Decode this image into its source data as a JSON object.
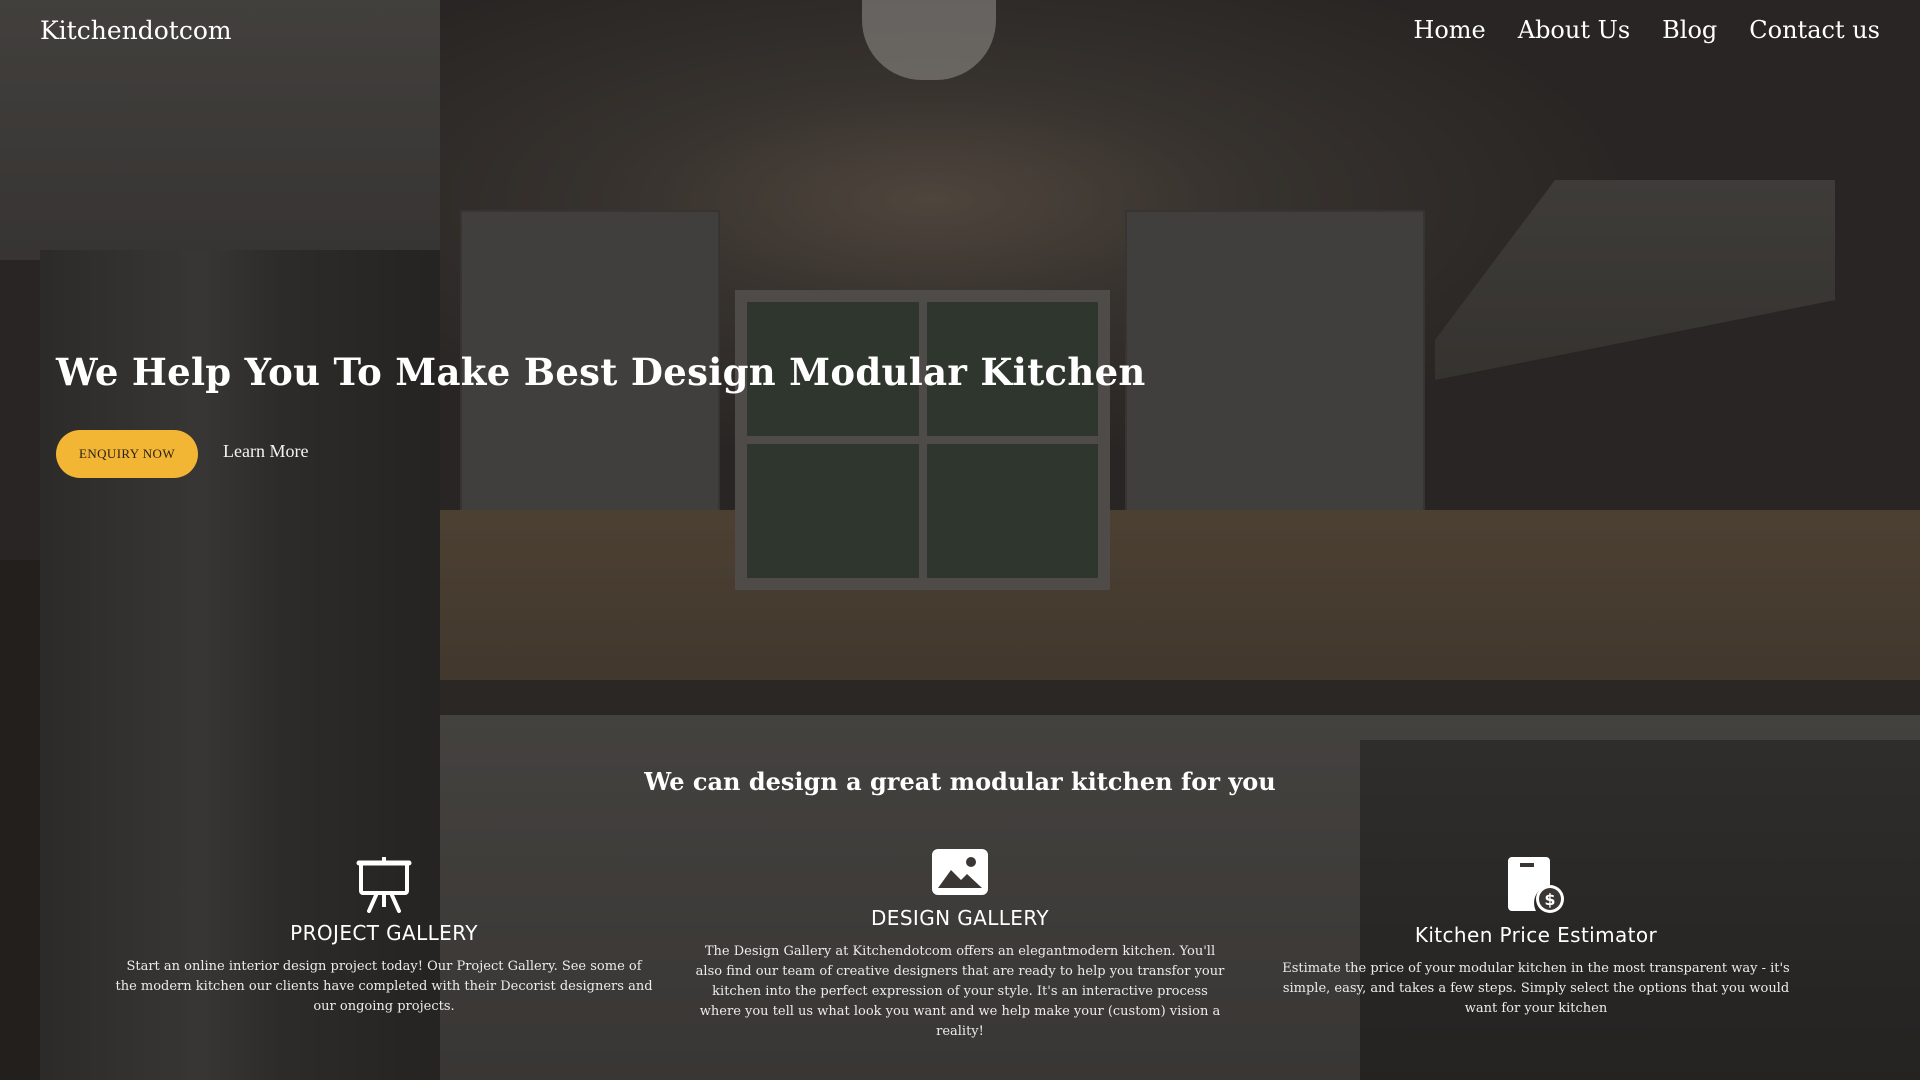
{
  "header": {
    "brand": "Kitchendotcom",
    "nav": [
      "Home",
      "About Us",
      "Blog",
      "Contact us"
    ]
  },
  "hero": {
    "title": "We Help You To Make Best Design Modular Kitchen",
    "enquiry_label": "ENQUIRY NOW",
    "learn_more_label": "Learn More"
  },
  "features": {
    "section_title": "We can design a great modular kitchen for you",
    "items": [
      {
        "icon": "presentation-board-icon",
        "title": "PROJECT GALLERY",
        "text": "Start an online interior design project today! Our Project Gallery. See some of the modern kitchen our clients have completed with their Decorist designers and our ongoing projects."
      },
      {
        "icon": "image-icon",
        "title": "DESIGN GALLERY",
        "text": "The Design Gallery at Kitchendotcom offers an elegantmodern kitchen. You'll also find our team of creative designers that are ready to help you transfor your kitchen into the perfect expression of your style. It's an interactive process where you tell us what look you want and we help make your (custom) vision a reality!"
      },
      {
        "icon": "price-calculator-icon",
        "title": "Kitchen Price Estimator",
        "text": "Estimate the price of your modular kitchen in the most transparent way - it's simple, easy, and takes a few steps. Simply select the options that you would want for your kitchen"
      }
    ]
  },
  "colors": {
    "accent": "#f2b534",
    "text": "#ffffff"
  }
}
